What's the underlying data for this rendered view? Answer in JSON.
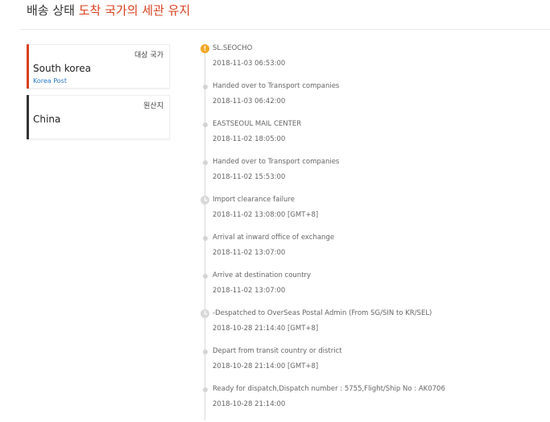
{
  "header": {
    "prefix": "배송 상태",
    "status": "도착 국가의 세관 유지"
  },
  "destination": {
    "label": "대상 국가",
    "country": "South korea",
    "carrier": "Korea Post"
  },
  "origin": {
    "label": "원산지",
    "country": "China"
  },
  "events": [
    {
      "title": "SL.SEOCHO",
      "time": "2018-11-03 06:53:00",
      "icon": "warning-icon"
    },
    {
      "title": "Handed over to Transport companies",
      "time": "2018-11-03 06:42:00",
      "icon": "dot"
    },
    {
      "title": "EASTSEOUL MAIL CENTER",
      "time": "2018-11-02 18:05:00",
      "icon": "dot"
    },
    {
      "title": "Handed over to Transport companies",
      "time": "2018-11-02 15:53:00",
      "icon": "dot"
    },
    {
      "title": "Import clearance failure",
      "time": "2018-11-02 13:08:00 [GMT+8]",
      "icon": "clock-icon"
    },
    {
      "title": "Arrival at inward office of exchange",
      "time": "2018-11-02 13:07:00",
      "icon": "dot"
    },
    {
      "title": "Arrive at destination country",
      "time": "2018-11-02 13:07:00",
      "icon": "dot"
    },
    {
      "title": "-Despatched to OverSeas Postal Admin (From SG/SIN to KR/SEL)",
      "time": "2018-10-28 21:14:40 [GMT+8]",
      "icon": "clock-icon"
    },
    {
      "title": "Depart from transit country or district",
      "time": "2018-10-28 21:14:00 [GMT+8]",
      "icon": "dot"
    },
    {
      "title": "Ready for dispatch,Dispatch number : 5755,Flight/Ship No : AK0706",
      "time": "2018-10-28 21:14:00",
      "icon": "dot"
    }
  ]
}
